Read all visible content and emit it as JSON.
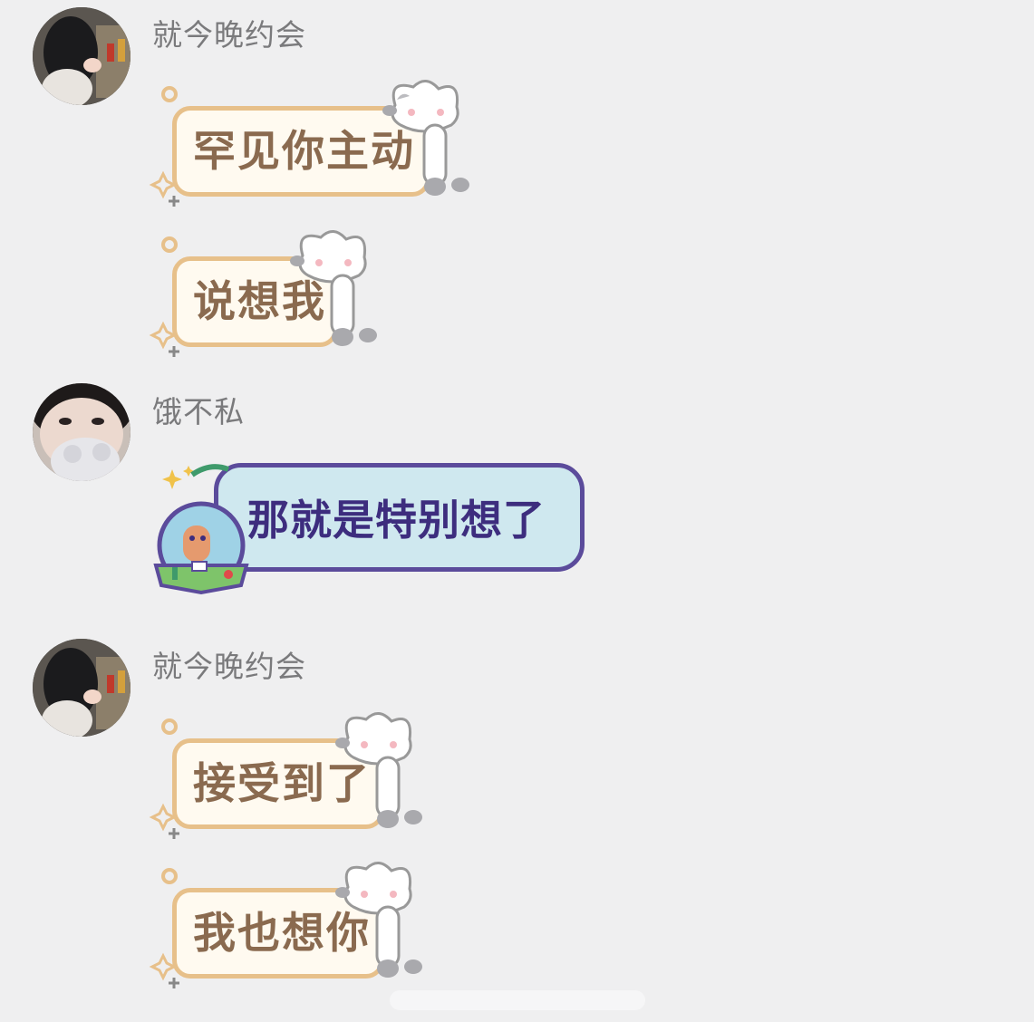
{
  "messages": [
    {
      "sender": "就今晚约会",
      "bubbles": [
        "罕见你主动",
        "说想我"
      ]
    },
    {
      "sender": "饿不私",
      "bubbles": [
        "那就是特别想了"
      ]
    },
    {
      "sender": "就今晚约会",
      "bubbles": [
        "接受到了",
        "我也想你"
      ]
    }
  ],
  "colors": {
    "background": "#efeff0",
    "cat_bubble_fill": "#fffaf0",
    "cat_bubble_border": "#e7c08a",
    "cat_bubble_text": "#8a6a4f",
    "blue_bubble_fill": "#cfe8ef",
    "blue_bubble_border": "#5b4b9b",
    "blue_bubble_text": "#3d2d7e"
  },
  "icons": {
    "bubble_decoration": "cat-bubble-decoration",
    "blue_bubble_decoration": "astronaut-bubble-decoration"
  }
}
